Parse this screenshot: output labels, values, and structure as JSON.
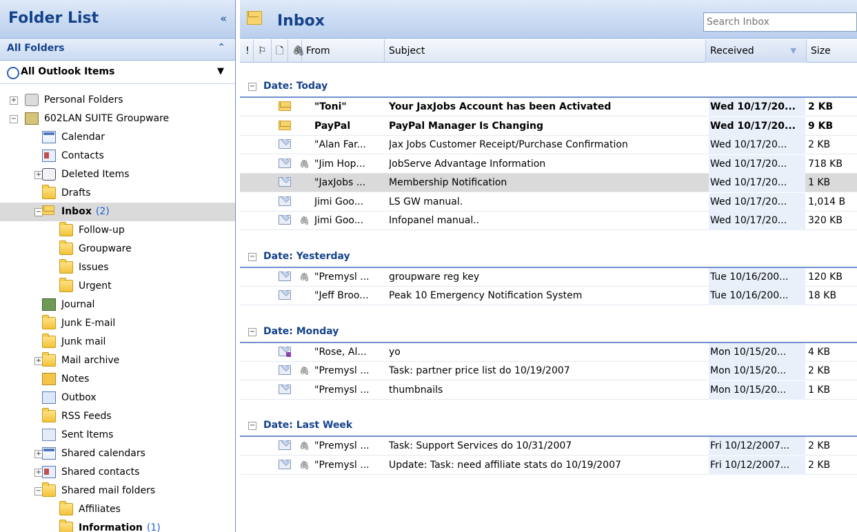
{
  "folder_pane": {
    "title": "Folder List",
    "collapse_glyph": "«",
    "all_folders_label": "All Folders",
    "all_folders_glyph": "⌃",
    "all_outlook_items": "All Outlook Items",
    "dropdown_glyph": "▼",
    "tree": [
      {
        "label": "Personal Folders",
        "count": "",
        "exp": "+",
        "icon": "personal-folders-icon"
      },
      {
        "label": "602LAN SUITE Groupware",
        "count": "",
        "exp": "−",
        "icon": "groupware-icon"
      },
      {
        "label": "Calendar",
        "count": "",
        "exp": "",
        "icon": "calendar-icon"
      },
      {
        "label": "Contacts",
        "count": "",
        "exp": "",
        "icon": "contacts-icon"
      },
      {
        "label": "Deleted Items",
        "count": "",
        "exp": "+",
        "icon": "deleted-items-icon"
      },
      {
        "label": "Drafts",
        "count": "",
        "exp": "",
        "icon": "folder-icon"
      },
      {
        "label": "Inbox",
        "count": "(2)",
        "exp": "−",
        "icon": "inbox-icon"
      },
      {
        "label": "Follow-up",
        "count": "",
        "exp": "",
        "icon": "folder-icon"
      },
      {
        "label": "Groupware",
        "count": "",
        "exp": "",
        "icon": "folder-icon"
      },
      {
        "label": "Issues",
        "count": "",
        "exp": "",
        "icon": "folder-icon"
      },
      {
        "label": "Urgent",
        "count": "",
        "exp": "",
        "icon": "folder-icon"
      },
      {
        "label": "Journal",
        "count": "",
        "exp": "",
        "icon": "journal-icon"
      },
      {
        "label": "Junk E-mail",
        "count": "",
        "exp": "",
        "icon": "folder-icon"
      },
      {
        "label": "Junk mail",
        "count": "",
        "exp": "",
        "icon": "folder-icon"
      },
      {
        "label": "Mail archive",
        "count": "",
        "exp": "+",
        "icon": "folder-icon"
      },
      {
        "label": "Notes",
        "count": "",
        "exp": "",
        "icon": "notes-icon"
      },
      {
        "label": "Outbox",
        "count": "",
        "exp": "",
        "icon": "outbox-icon"
      },
      {
        "label": "RSS Feeds",
        "count": "",
        "exp": "",
        "icon": "folder-icon"
      },
      {
        "label": "Sent Items",
        "count": "",
        "exp": "",
        "icon": "sent-items-icon"
      },
      {
        "label": "Shared calendars",
        "count": "",
        "exp": "+",
        "icon": "calendar-icon"
      },
      {
        "label": "Shared contacts",
        "count": "",
        "exp": "+",
        "icon": "contacts-icon"
      },
      {
        "label": "Shared mail folders",
        "count": "",
        "exp": "−",
        "icon": "folder-icon"
      },
      {
        "label": "Affiliates",
        "count": "",
        "exp": "",
        "icon": "folder-icon"
      },
      {
        "label": "Information",
        "count": "(1)",
        "exp": "",
        "icon": "folder-icon"
      }
    ]
  },
  "inbox": {
    "title": "Inbox",
    "search_placeholder": "Search Inbox",
    "columns": {
      "importance": "!",
      "reminder": "⚐",
      "icon": "🗋",
      "attachment": "🖇",
      "from": "From",
      "subject": "Subject",
      "received": "Received",
      "sort_glyph": "▼",
      "size": "Size"
    },
    "groups": [
      {
        "label": "Date: Today",
        "messages": [
          {
            "from": "\"Toni\"",
            "subject": "Your JaxJobs Account has been Activated",
            "received": "Wed 10/17/20...",
            "size": "2 KB",
            "unread": true,
            "attachment": false,
            "replied": false,
            "selected": false
          },
          {
            "from": "PayPal",
            "subject": "PayPal Manager Is Changing",
            "received": "Wed 10/17/20...",
            "size": "9 KB",
            "unread": true,
            "attachment": false,
            "replied": false,
            "selected": false
          },
          {
            "from": "\"Alan Far...",
            "subject": "Jax Jobs Customer Receipt/Purchase Confirmation",
            "received": "Wed 10/17/20...",
            "size": "2 KB",
            "unread": false,
            "attachment": false,
            "replied": false,
            "selected": false
          },
          {
            "from": "\"Jim Hop...",
            "subject": "JobServe Advantage Information",
            "received": "Wed 10/17/20...",
            "size": "718 KB",
            "unread": false,
            "attachment": true,
            "replied": false,
            "selected": false
          },
          {
            "from": "\"JaxJobs ...",
            "subject": "Membership Notification",
            "received": "Wed 10/17/20...",
            "size": "1 KB",
            "unread": false,
            "attachment": false,
            "replied": false,
            "selected": true
          },
          {
            "from": "Jimi Goo...",
            "subject": "LS GW manual.",
            "received": "Wed 10/17/20...",
            "size": "1,014 B",
            "unread": false,
            "attachment": false,
            "replied": false,
            "selected": false
          },
          {
            "from": "Jimi Goo...",
            "subject": "Infopanel manual..",
            "received": "Wed 10/17/20...",
            "size": "320 KB",
            "unread": false,
            "attachment": true,
            "replied": false,
            "selected": false
          }
        ]
      },
      {
        "label": "Date: Yesterday",
        "messages": [
          {
            "from": "\"Premysl ...",
            "subject": "groupware reg key",
            "received": "Tue 10/16/200...",
            "size": "120 KB",
            "unread": false,
            "attachment": true,
            "replied": false,
            "selected": false
          },
          {
            "from": "\"Jeff Broo...",
            "subject": "Peak 10 Emergency Notification System",
            "received": "Tue 10/16/200...",
            "size": "18 KB",
            "unread": false,
            "attachment": false,
            "replied": false,
            "selected": false
          }
        ]
      },
      {
        "label": "Date: Monday",
        "messages": [
          {
            "from": "\"Rose, Al...",
            "subject": "yo",
            "received": "Mon 10/15/20...",
            "size": "4 KB",
            "unread": false,
            "attachment": false,
            "replied": true,
            "selected": false
          },
          {
            "from": "\"Premysl ...",
            "subject": "Task: partner price list do 10/19/2007",
            "received": "Mon 10/15/20...",
            "size": "2 KB",
            "unread": false,
            "attachment": true,
            "replied": false,
            "selected": false
          },
          {
            "from": "\"Premysl ...",
            "subject": "thumbnails",
            "received": "Mon 10/15/20...",
            "size": "1 KB",
            "unread": false,
            "attachment": false,
            "replied": false,
            "selected": false
          }
        ]
      },
      {
        "label": "Date: Last Week",
        "messages": [
          {
            "from": "\"Premysl ...",
            "subject": "Task: Support Services do 10/31/2007",
            "received": "Fri 10/12/2007...",
            "size": "2 KB",
            "unread": false,
            "attachment": true,
            "replied": false,
            "selected": false
          },
          {
            "from": "\"Premysl ...",
            "subject": "Update: Task: need affiliate stats do 10/19/2007",
            "received": "Fri 10/12/2007...",
            "size": "2 KB",
            "unread": false,
            "attachment": true,
            "replied": false,
            "selected": false
          }
        ]
      }
    ]
  },
  "colors": {
    "header_text": "#15428b",
    "group_line": "#6f8fcf",
    "selection": "#dadada",
    "unread_count": "#1f5fd1"
  }
}
